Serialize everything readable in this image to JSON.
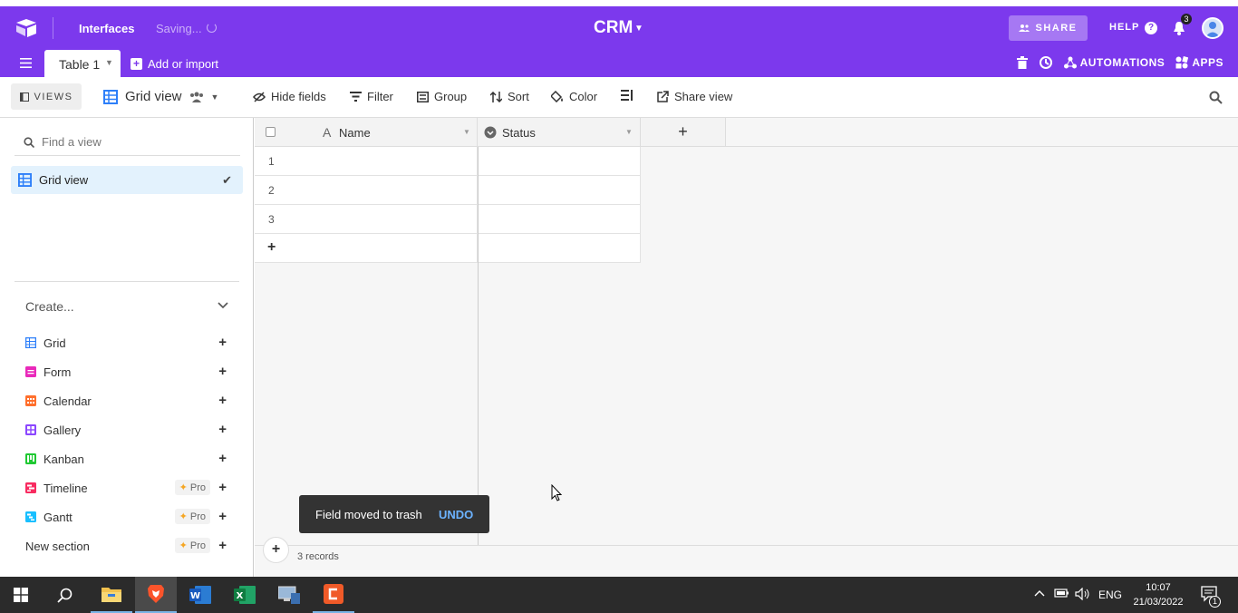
{
  "header": {
    "interfaces_label": "Interfaces",
    "saving_label": "Saving...",
    "base_name": "CRM",
    "share_label": "SHARE",
    "help_label": "HELP",
    "help_icon_text": "?",
    "notification_count": "3",
    "table_tab": "Table 1",
    "add_import": "Add or import",
    "automations": "AUTOMATIONS",
    "apps": "APPS"
  },
  "toolbar": {
    "views_label": "VIEWS",
    "view_name": "Grid view",
    "hide_fields": "Hide fields",
    "filter": "Filter",
    "group": "Group",
    "sort": "Sort",
    "color": "Color",
    "share_view": "Share view"
  },
  "sidebar": {
    "find_placeholder": "Find a view",
    "selected_view": "Grid view",
    "create_label": "Create...",
    "pro_label": "Pro",
    "create_items": [
      {
        "label": "Grid",
        "color": "#2d7ff9"
      },
      {
        "label": "Form",
        "color": "#e929ba"
      },
      {
        "label": "Calendar",
        "color": "#ff6f2c"
      },
      {
        "label": "Gallery",
        "color": "#8b46ff"
      },
      {
        "label": "Kanban",
        "color": "#20c933"
      },
      {
        "label": "Timeline",
        "color": "#f82b60"
      },
      {
        "label": "Gantt",
        "color": "#18bfff"
      },
      {
        "label": "New section",
        "color": ""
      }
    ]
  },
  "grid": {
    "columns": [
      "Name",
      "Status"
    ],
    "rows": [
      "1",
      "2",
      "3"
    ],
    "add_row": "+",
    "add_column": "+",
    "records_label": "3 records"
  },
  "toast": {
    "message": "Field moved to trash",
    "action": "UNDO"
  },
  "taskbar": {
    "language": "ENG",
    "time": "10:07",
    "date": "21/03/2022",
    "notif_count": "1"
  },
  "colors": {
    "brand": "#7c39ed",
    "selected_view_bg": "#e3f2fd",
    "toast_bg": "#333333",
    "undo": "#6cb3ff"
  }
}
